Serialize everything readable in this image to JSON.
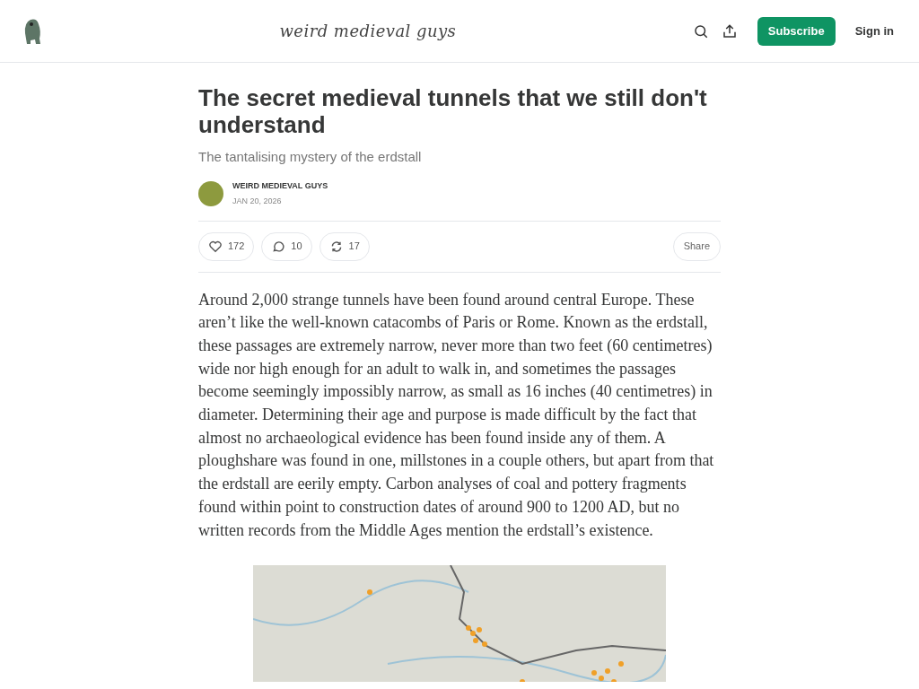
{
  "header": {
    "logo_text": "weird medieval guys",
    "subscribe": "Subscribe",
    "sign_in": "Sign in"
  },
  "post": {
    "title": "The secret medieval tunnels that we still don't understand",
    "subtitle": "The tantalising mystery of the erdstall",
    "author": "WEIRD MEDIEVAL GUYS",
    "date": "JAN 20, 2026"
  },
  "actions": [
    {
      "kind": "like",
      "count": "172"
    },
    {
      "kind": "comment",
      "count": "10"
    },
    {
      "kind": "restack",
      "count": "17"
    }
  ],
  "share": "Share",
  "body": "Around 2,000 strange tunnels have been found around central Europe. These aren’t like the well-known catacombs of Paris or Rome. Known as the erdstall, these passages are extremely narrow, never more than two feet (60 centimetres) wide nor high enough for an adult to walk in, and sometimes the passages become seemingly impossibly narrow, as small as 16 inches (40 centimetres) in diameter. Determining their age and purpose is made difficult by the fact that almost no archaeological evidence has been found inside any of them. A ploughshare was found in one, millstones in a couple others, but apart from that the erdstall are eerily empty. Carbon analyses of coal and pottery fragments found within point to construction dates of around 900 to 1200 AD, but no written records from the Middle Ages mention the erdstall’s existence."
}
